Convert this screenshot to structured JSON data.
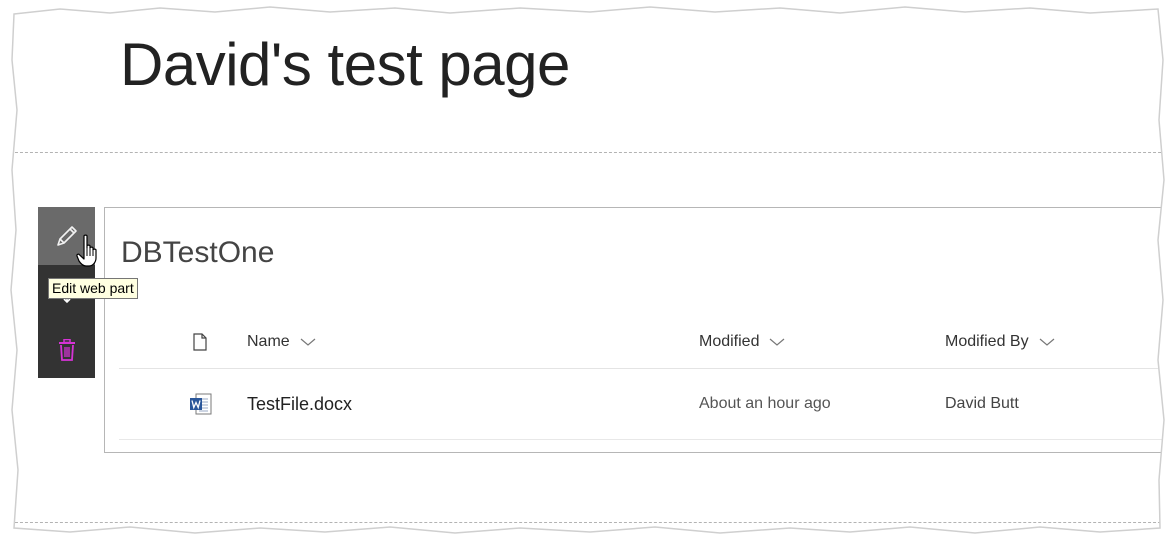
{
  "page": {
    "title": "David's test page"
  },
  "toolbar": {
    "buttons": [
      {
        "name": "edit",
        "icon": "pencil-icon"
      },
      {
        "name": "move",
        "icon": "move-icon"
      },
      {
        "name": "delete",
        "icon": "trash-icon",
        "color": "#d633d6"
      }
    ]
  },
  "tooltip": {
    "text": "Edit web part"
  },
  "webpart": {
    "title": "DBTestOne",
    "columns": [
      {
        "key": "type",
        "label": "",
        "icon": "document-icon"
      },
      {
        "key": "name",
        "label": "Name",
        "icon": "chevron-down-icon"
      },
      {
        "key": "modified",
        "label": "Modified",
        "icon": "chevron-down-icon"
      },
      {
        "key": "modified_by",
        "label": "Modified By",
        "icon": "chevron-down-icon"
      }
    ],
    "rows": [
      {
        "icon": "word-document-icon",
        "name": "TestFile.docx",
        "modified": "About an hour ago",
        "modified_by": "David Butt"
      }
    ]
  },
  "colors": {
    "toolbar_bg": "#333333",
    "toolbar_active": "#6a6a6a",
    "delete_icon": "#d633d6",
    "word_blue": "#2b579a",
    "tooltip_bg": "#ffffe1"
  }
}
